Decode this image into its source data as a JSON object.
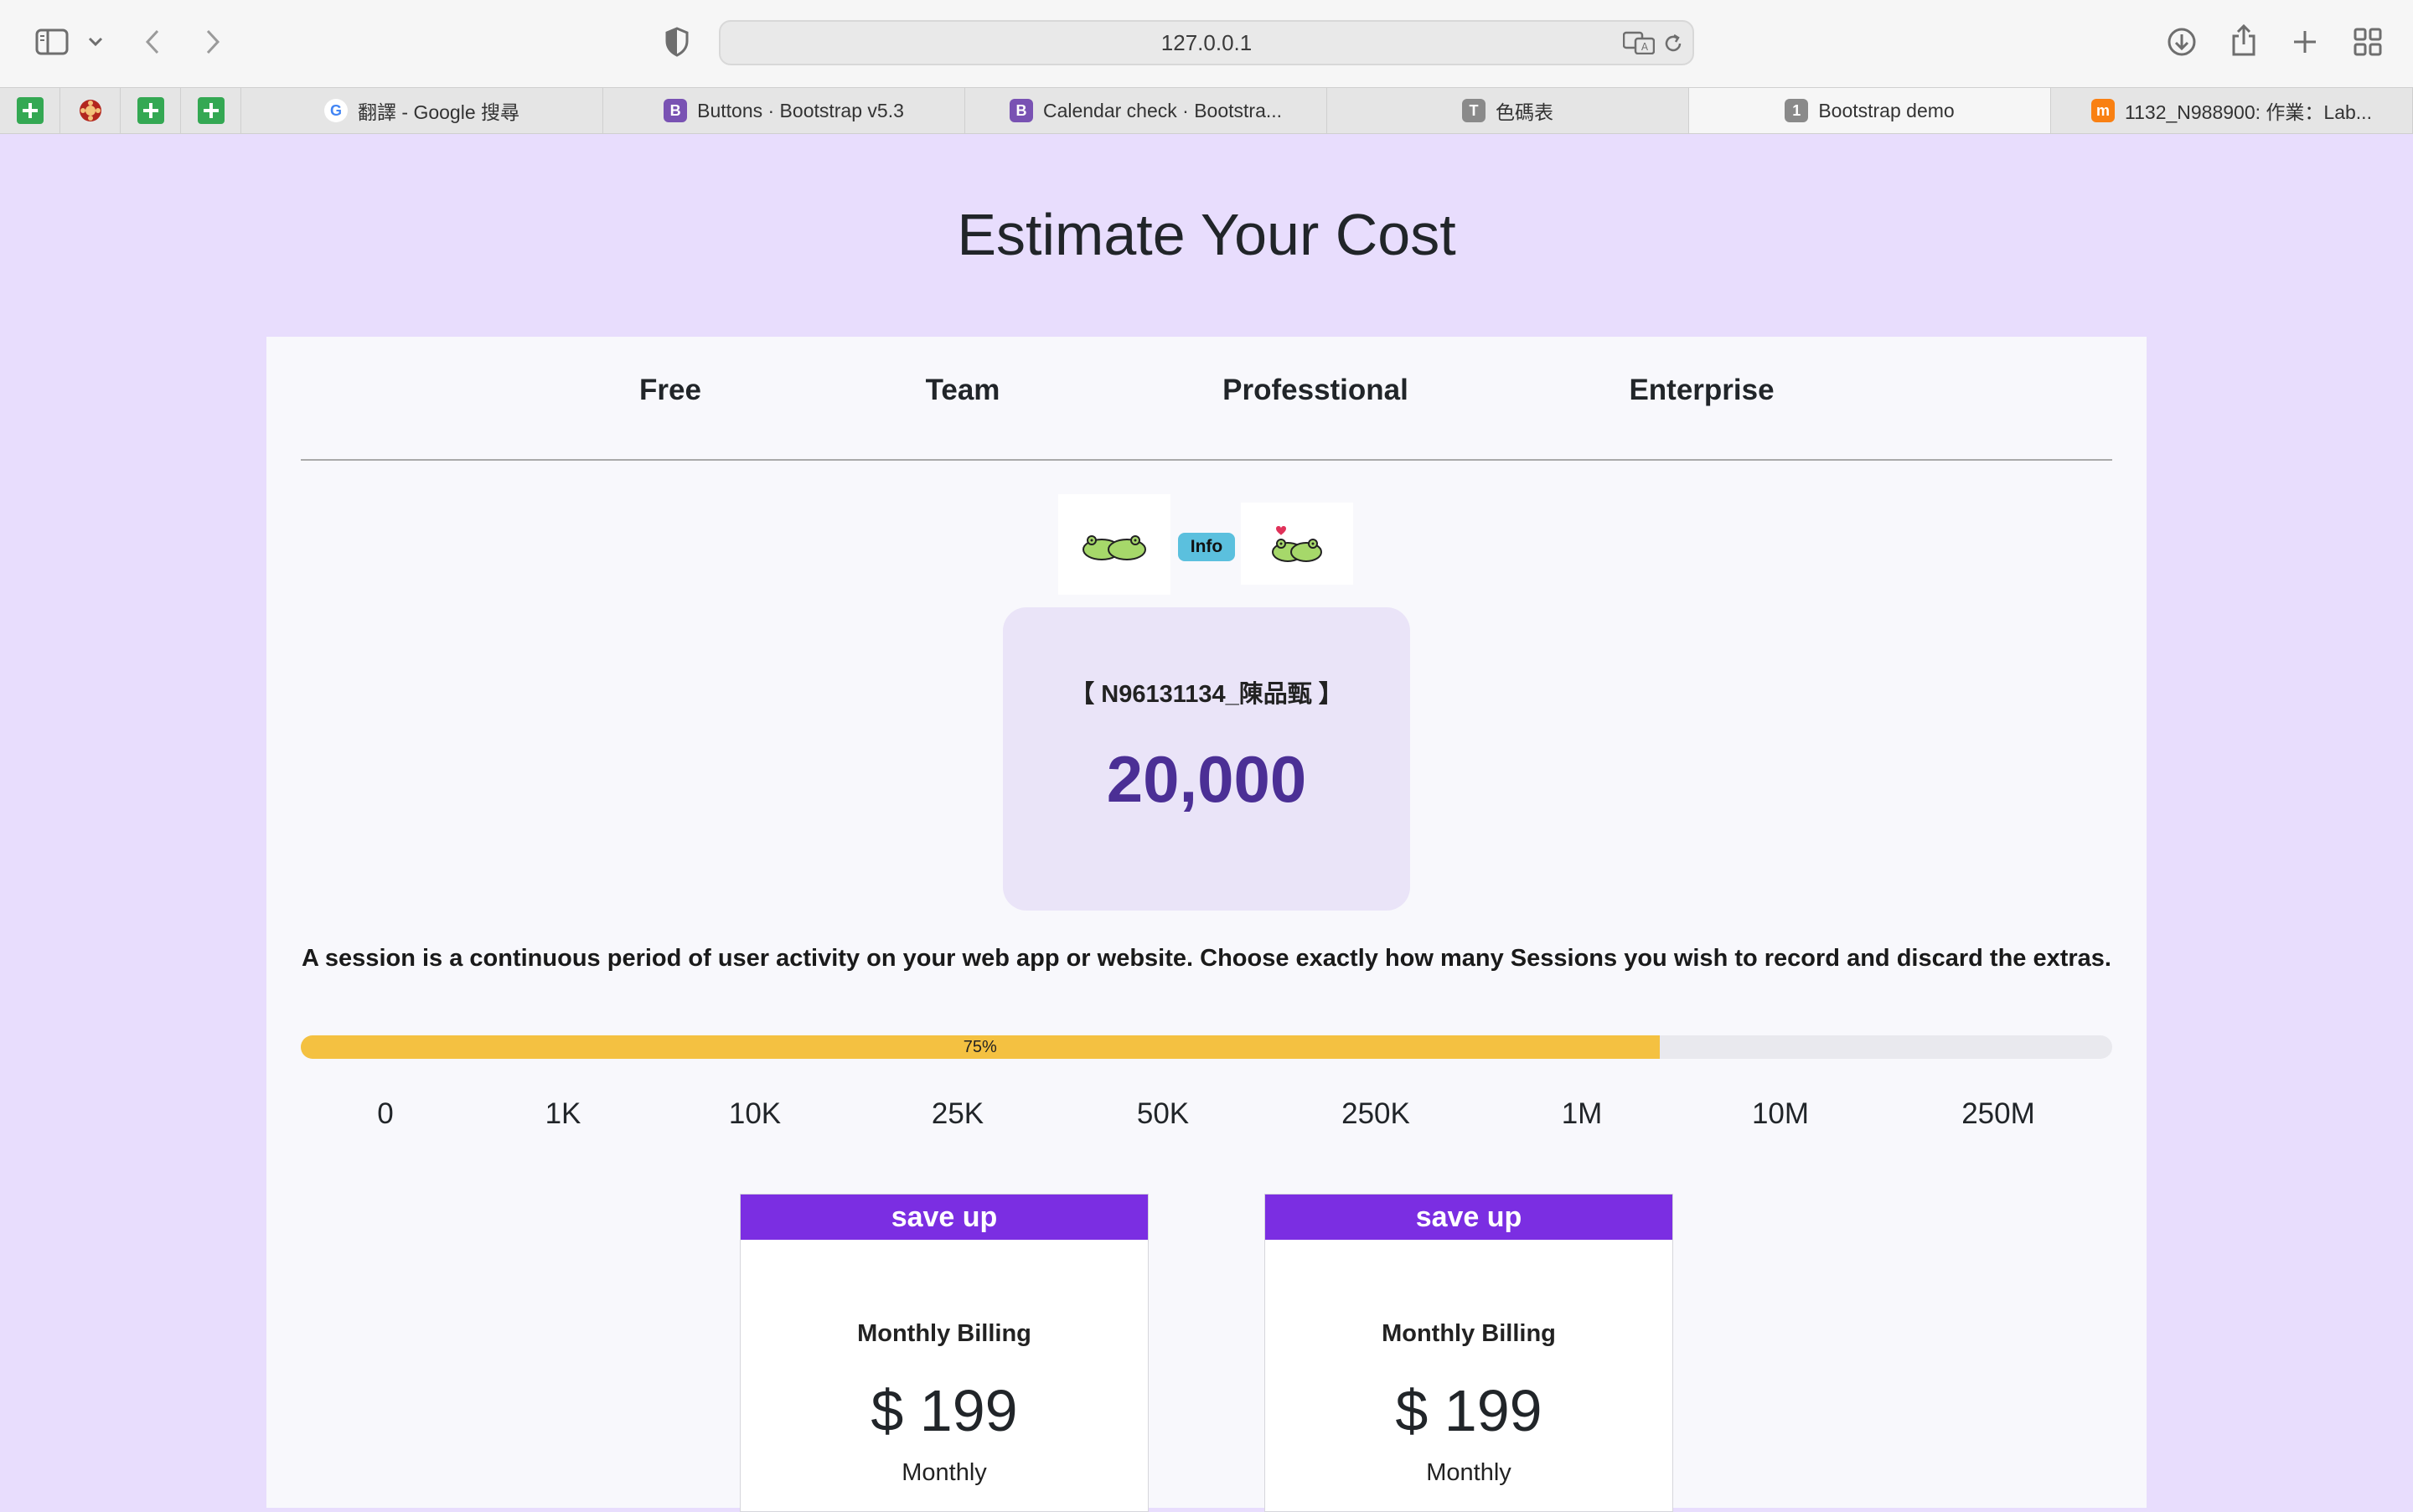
{
  "browser": {
    "url": "127.0.0.1",
    "pinned_tabs": [
      {
        "icon": "google-sheets-icon"
      },
      {
        "icon": "university-logo-icon"
      },
      {
        "icon": "google-sheets-icon"
      },
      {
        "icon": "google-sheets-icon"
      }
    ],
    "tabs": [
      {
        "favicon_text": "G",
        "title": "翻譯 - Google 搜尋",
        "active": false
      },
      {
        "favicon_text": "B",
        "title": "Buttons · Bootstrap v5.3",
        "active": false
      },
      {
        "favicon_text": "B",
        "title": "Calendar check · Bootstra...",
        "active": false
      },
      {
        "favicon_text": "T",
        "title": "色碼表",
        "active": false
      },
      {
        "favicon_text": "1",
        "title": "Bootstrap demo",
        "active": true
      },
      {
        "favicon_text": "m",
        "title": "1132_N988900: 作業：Lab...",
        "active": false
      }
    ]
  },
  "page": {
    "title": "Estimate Your Cost",
    "plans": [
      "Free",
      "Team",
      "Professtional",
      "Enterprise"
    ],
    "info_badge": "Info",
    "student_label": "【 N96131134_陳品甄 】",
    "sessions_value": "20,000",
    "description": "A session is a continuous period of user activity on your web app or website. Choose exactly how many Sessions you wish to record and discard the extras.",
    "progress": {
      "percent": 75,
      "label": "75%"
    },
    "ticks": [
      "0",
      "1K",
      "10K",
      "25K",
      "50K",
      "250K",
      "1M",
      "10M",
      "250M"
    ],
    "pricing_cards": [
      {
        "header": "save up",
        "title": "Monthly Billing",
        "amount": "$ 199",
        "period": "Monthly"
      },
      {
        "header": "save up",
        "title": "Monthly Billing",
        "amount": "$ 199",
        "period": "Monthly"
      }
    ]
  },
  "colors": {
    "page_bg": "#e8ddfd",
    "card_bg": "#f8f8fc",
    "stat_bg": "#eae4f8",
    "stat_value": "#4b2f95",
    "progress_fill": "#f4c141",
    "info_badge": "#5bc0de",
    "price_header": "#7b2ee2"
  }
}
